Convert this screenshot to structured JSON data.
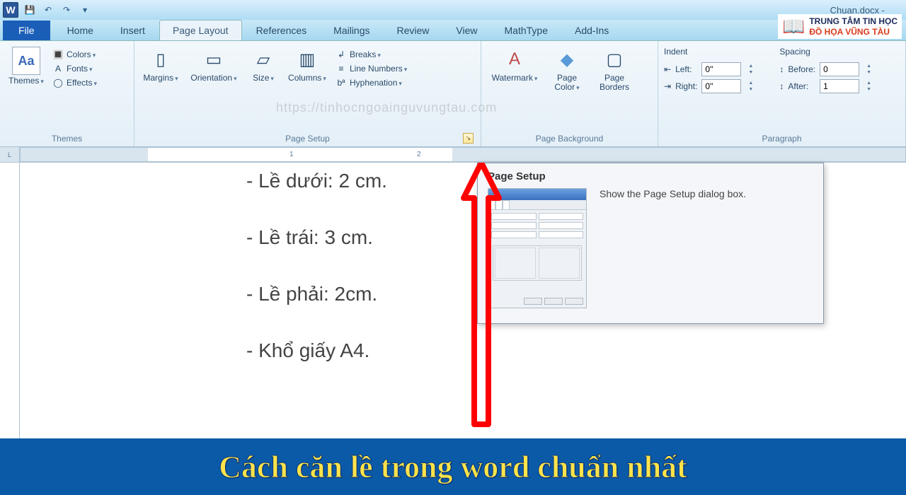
{
  "titlebar": {
    "doc_title": "Chuan.docx -"
  },
  "tabs": {
    "file": "File",
    "items": [
      "Home",
      "Insert",
      "Page Layout",
      "References",
      "Mailings",
      "Review",
      "View",
      "MathType",
      "Add-Ins"
    ],
    "active_index": 2
  },
  "ribbon": {
    "themes": {
      "label": "Themes",
      "themes_btn": "Themes",
      "colors": "Colors",
      "fonts": "Fonts",
      "effects": "Effects"
    },
    "page_setup": {
      "label": "Page Setup",
      "margins": "Margins",
      "orientation": "Orientation",
      "size": "Size",
      "columns": "Columns",
      "breaks": "Breaks",
      "line_numbers": "Line Numbers",
      "hyphenation": "Hyphenation"
    },
    "page_background": {
      "label": "Page Background",
      "watermark": "Watermark",
      "page_color": "Page Color",
      "page_borders": "Page Borders"
    },
    "paragraph": {
      "label": "Paragraph",
      "indent_title": "Indent",
      "spacing_title": "Spacing",
      "left_label": "Left:",
      "right_label": "Right:",
      "before_label": "Before:",
      "after_label": "After:",
      "left_val": "0\"",
      "right_val": "0\"",
      "before_val": "0",
      "after_val": "1"
    }
  },
  "tooltip": {
    "title": "Page Setup",
    "desc": "Show the Page Setup dialog box."
  },
  "document": {
    "lines": [
      "- Lề dưới: 2 cm.",
      "- Lề trái: 3 cm.",
      "- Lề phải: 2cm.",
      "- Khổ giấy A4."
    ]
  },
  "watermark_url": "https://tinhocngoainguvungtau.com",
  "corner": {
    "line1": "TRUNG TÂM TIN HỌC",
    "line2": "ĐỒ HỌA VŨNG TÀU"
  },
  "banner": {
    "text": "Cách căn lề trong word chuẩn nhất"
  },
  "ruler": {
    "marks": [
      "1",
      "2"
    ]
  }
}
